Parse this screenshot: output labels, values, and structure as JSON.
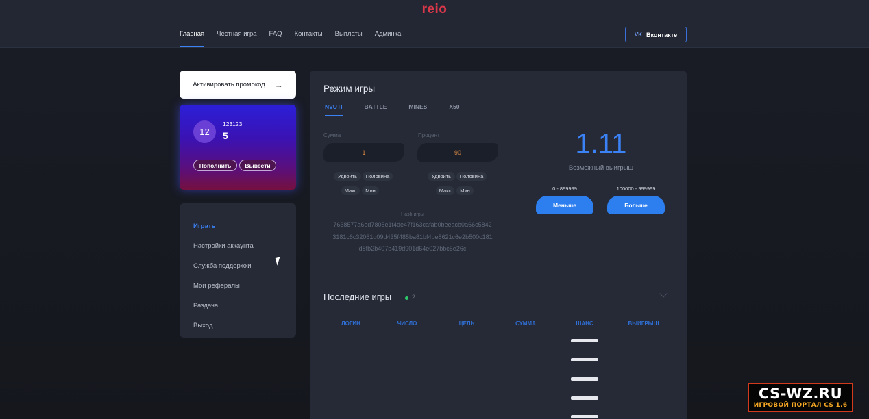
{
  "header": {
    "logo": "reio",
    "nav": [
      "Главная",
      "Честная игра",
      "FAQ",
      "Контакты",
      "Выплаты",
      "Админка"
    ],
    "vk_button": "Вконтакте",
    "vk_icon_text": "VK"
  },
  "sidebar": {
    "promo_label": "Активировать промокод",
    "profile": {
      "avatar_text": "12",
      "username": "123123",
      "balance": "5",
      "deposit_label": "Пополнить",
      "withdraw_label": "Вывести"
    },
    "menu": [
      "Играть",
      "Настройки аккаунта",
      "Служба поддержки",
      "Мои рефералы",
      "Раздача",
      "Выход"
    ]
  },
  "game": {
    "title": "Режим игры",
    "tabs": [
      "NVUTI",
      "BATTLE",
      "MINES",
      "X50"
    ],
    "amount_label": "Сумма",
    "amount_value": "1",
    "percent_label": "Процент",
    "percent_value": "90",
    "amount_chips": [
      "Удвоить",
      "Половина",
      "Макс",
      "Мин"
    ],
    "percent_chips": [
      "Удвоить",
      "Половина",
      "Макс",
      "Мин"
    ],
    "hash_label": "Hash игры",
    "hash_lines": [
      "7638577a6ed7805e1f4de47f163cafab0beeacb0a66c5842",
      "3181c6c32061d09d435f485ba81bf4be8621c6e2b500c181",
      "d8fb2b407b419d901d64e027bbc5e26c"
    ],
    "possible_win": "1.11",
    "possible_win_label": "Возможный выигрыш",
    "low_range": "0 - 899999",
    "high_range": "100000 - 999999",
    "low_button": "Меньше",
    "high_button": "Больше"
  },
  "recent": {
    "title": "Последние игры",
    "count": "2",
    "columns": [
      "ЛОГИН",
      "ЧИСЛО",
      "ЦЕЛЬ",
      "СУММА",
      "ШАНС",
      "ВЫИГРЫШ"
    ]
  },
  "watermark": {
    "title": "CS-WZ.RU",
    "subtitle": "ИГРОВОЙ ПОРТАЛ CS 1.6"
  },
  "colors": {
    "accent": "#3b82f6",
    "brand": "#d9374a",
    "background": "#1a1d26",
    "panel": "#252a36",
    "online": "#2ec86b"
  }
}
